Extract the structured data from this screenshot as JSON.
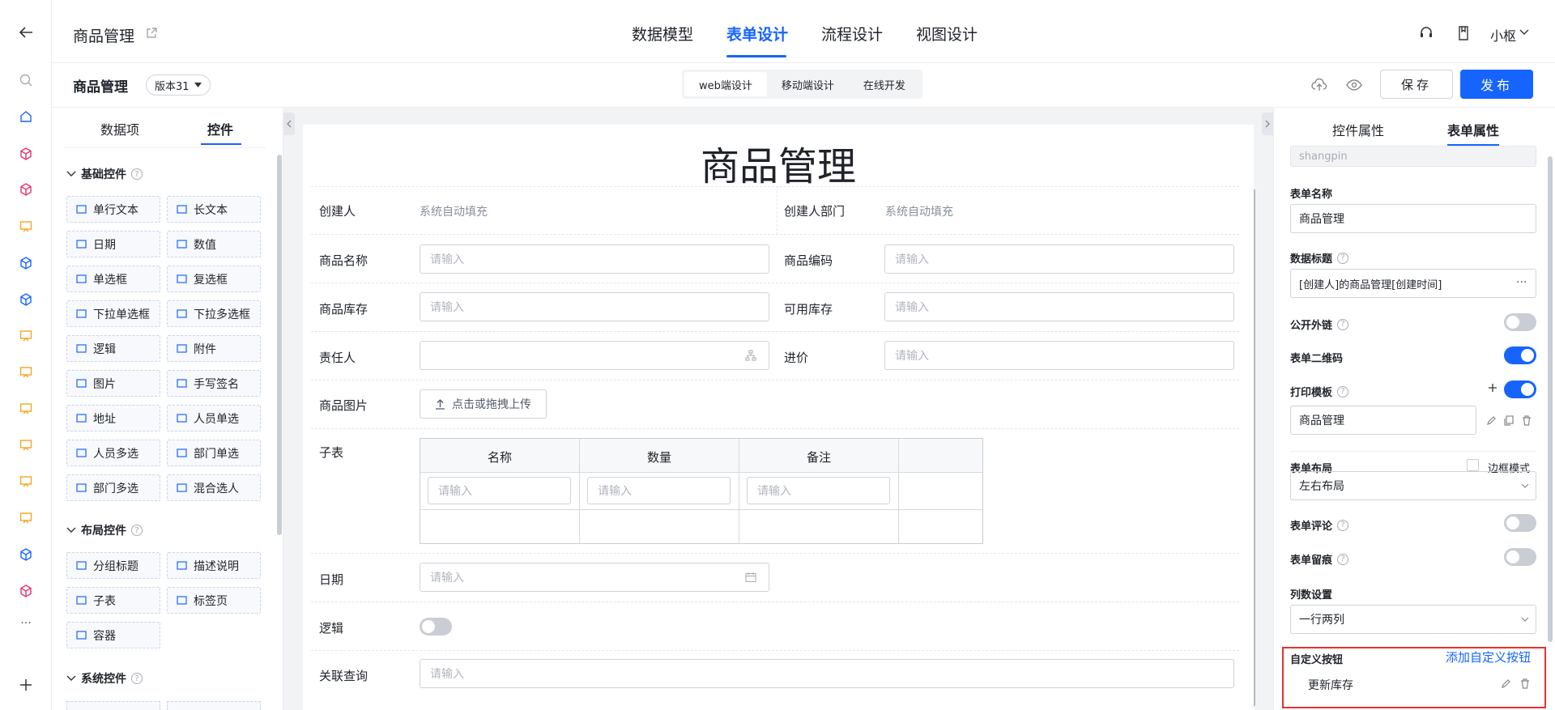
{
  "header": {
    "app_title": "商品管理",
    "tabs": [
      {
        "label": "数据模型"
      },
      {
        "label": "表单设计"
      },
      {
        "label": "流程设计"
      },
      {
        "label": "视图设计"
      }
    ],
    "user": "小枢"
  },
  "subbar": {
    "form_name": "商品管理",
    "version": "版本31",
    "modes": [
      {
        "label": "web端设计"
      },
      {
        "label": "移动端设计"
      },
      {
        "label": "在线开发"
      }
    ],
    "save": "保存",
    "publish": "发布"
  },
  "widgets": {
    "tabs": [
      "数据项",
      "控件"
    ],
    "sections": [
      {
        "title": "基础控件",
        "items": [
          "单行文本",
          "长文本",
          "日期",
          "数值",
          "单选框",
          "复选框",
          "下拉单选框",
          "下拉多选框",
          "逻辑",
          "附件",
          "图片",
          "手写签名",
          "地址",
          "人员单选",
          "人员多选",
          "部门单选",
          "部门多选",
          "混合选人"
        ]
      },
      {
        "title": "布局控件",
        "items": [
          "分组标题",
          "描述说明",
          "子表",
          "标签页",
          "容器"
        ]
      },
      {
        "title": "系统控件",
        "items": []
      }
    ]
  },
  "form": {
    "title": "商品管理",
    "placeholder": "请输入",
    "auto_fill": "系统自动填充",
    "fields": {
      "creator": "创建人",
      "creator_dept": "创建人部门",
      "name": "商品名称",
      "code": "商品编码",
      "stock": "商品库存",
      "available": "可用库存",
      "owner": "责任人",
      "price": "进价",
      "image": "商品图片",
      "upload": "点击或拖拽上传",
      "subtable": "子表",
      "date": "日期",
      "logic": "逻辑",
      "query": "关联查询"
    },
    "subtable_columns": [
      "名称",
      "数量",
      "备注"
    ]
  },
  "props": {
    "tabs": [
      "控件属性",
      "表单属性"
    ],
    "code_value": "shangpin",
    "form_name_label": "表单名称",
    "form_name_value": "商品管理",
    "data_title_label": "数据标题",
    "data_title_value": "[创建人]的商品管理[创建时间]",
    "public_link_label": "公开外链",
    "qrcode_label": "表单二维码",
    "print_label": "打印模板",
    "print_value": "商品管理",
    "layout_label": "表单布局",
    "border_mode_label": "边框模式",
    "layout_value": "左右布局",
    "comment_label": "表单评论",
    "trace_label": "表单留痕",
    "columns_label": "列数设置",
    "columns_value": "一行两列",
    "custom_btn_label": "自定义按钮",
    "add_custom_btn": "添加自定义按钮",
    "custom_btn_item": "更新库存",
    "toggles": {
      "public_link": false,
      "qrcode": true,
      "print": true,
      "comment": false,
      "trace": false
    },
    "highlight_color": "#e5322d"
  },
  "theme": {
    "accent": "#1664ff"
  }
}
